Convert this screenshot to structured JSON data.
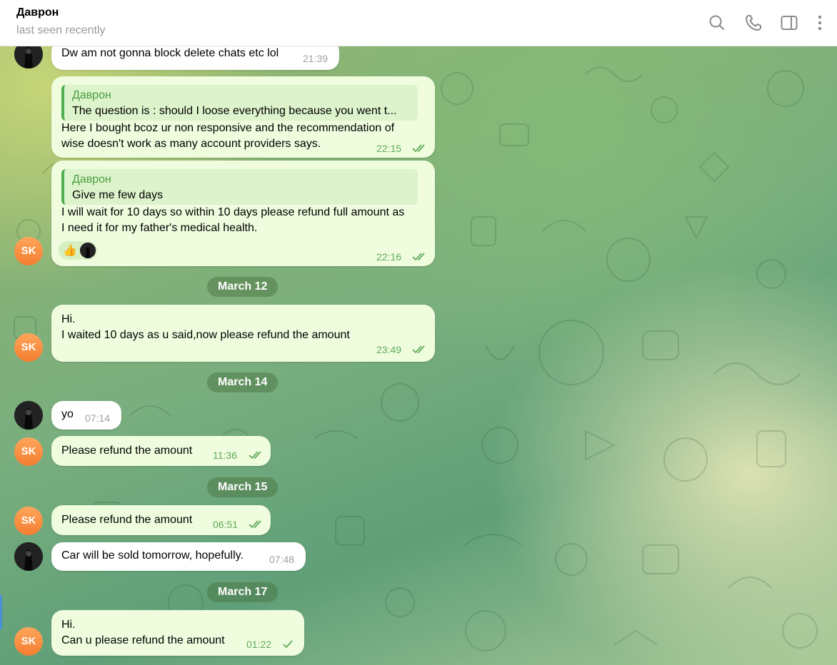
{
  "header": {
    "contact_name": "Даврон",
    "status": "last seen recently",
    "icons": [
      "search-icon",
      "phone-icon",
      "sidebar-toggle-icon",
      "more-vertical-icon"
    ]
  },
  "colors": {
    "outgoing_bubble": "#effdde",
    "incoming_bubble": "#ffffff",
    "accent_green": "#4fae4e",
    "avatar_orange": "#f47e30"
  },
  "avatars": {
    "sk_initials": "SK"
  },
  "messages": [
    {
      "direction": "in",
      "text": "Dw am not gonna block delete chats etc lol",
      "time": "21:39"
    },
    {
      "direction": "out",
      "reply_to": {
        "name": "Даврон",
        "text": "The question is : should I loose everything because you went t..."
      },
      "lines": [
        "Here I bought bcoz ur non responsive and the recommendation of",
        "wise doesn't work as many account providers says."
      ],
      "time": "22:15",
      "read": true
    },
    {
      "direction": "out",
      "reply_to": {
        "name": "Даврон",
        "text": "Give me few days"
      },
      "lines": [
        "I will wait for 10 days so within 10 days please refund full amount as",
        "I need it for my father's medical health."
      ],
      "time": "22:16",
      "read": true,
      "reaction": "👍"
    },
    {
      "direction": "out",
      "lines": [
        "Hi.",
        "I waited 10 days as u said,now please refund the amount"
      ],
      "time": "23:49",
      "read": true
    },
    {
      "direction": "in",
      "text": "yo",
      "time": "07:14"
    },
    {
      "direction": "out",
      "text": "Please refund the amount",
      "time": "11:36",
      "read": true
    },
    {
      "direction": "out",
      "text": "Please refund the amount",
      "time": "06:51",
      "read": true
    },
    {
      "direction": "in",
      "text": "Car will be sold tomorrow, hopefully.",
      "time": "07:48"
    },
    {
      "direction": "out",
      "lines": [
        "Hi.",
        "Can u please refund the amount"
      ],
      "time": "01:22",
      "read": false
    }
  ],
  "dates": [
    "March 12",
    "March 14",
    "March 15",
    "March 17"
  ]
}
